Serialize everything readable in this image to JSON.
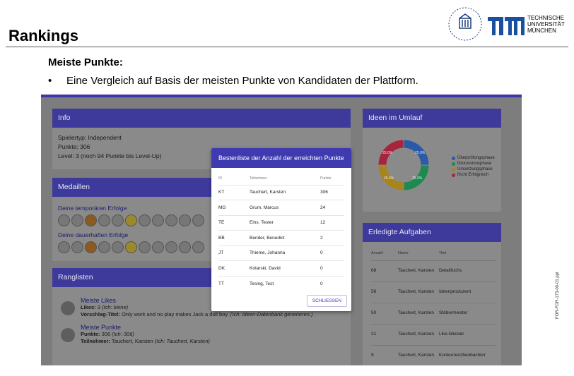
{
  "slide": {
    "title": "Rankings",
    "section_heading": "Meiste Punkte:",
    "bullet": "Eine Vergleich auf Basis der meisten Punkte von Kandidaten der Plattform.",
    "logo_text": [
      "TECHNISCHE",
      "UNIVERSITÄT",
      "MÜNCHEN"
    ],
    "side_code": "FOR-FOR-173-00-01.ppt"
  },
  "info": {
    "title": "Info",
    "lines": [
      "Spielertyp: Independent",
      "Punkte: 306",
      "Level: 3 (noch 94 Punkte bis Level-Up)"
    ]
  },
  "medals": {
    "title": "Medaillen",
    "temp_label": "Deine temporären Erfolge",
    "perm_label": "Deine dauerhaften Erfolge"
  },
  "ranklists": {
    "title": "Ranglisten",
    "items": [
      {
        "name": "Meiste Likes",
        "line1_label": "Likes:",
        "line1_value": "3",
        "line1_note": "(Ich: keine)",
        "line2_label": "Vorschlag-Titel:",
        "line2_value": "Only work and no play makes Jack a dull boy.",
        "line2_note": "(Ich: Ideen-Datenbank generieren.)"
      },
      {
        "name": "Meiste Punkte",
        "line1_label": "Punkte:",
        "line1_value": "306",
        "line1_note": "(Ich: 306)",
        "line2_label": "Teilnehmer:",
        "line2_value": "Tauchert, Karsten",
        "line2_note": "(Ich: Tauchert, Karsten)"
      }
    ]
  },
  "ideas": {
    "title": "Ideen im Umlauf",
    "legend": [
      {
        "label": "Überprüfungsphase",
        "color": "#2a5aa8"
      },
      {
        "label": "Diskussionsphase",
        "color": "#1e8a52"
      },
      {
        "label": "Umsetzungsphase",
        "color": "#a8841c"
      },
      {
        "label": "Nicht Erfolgreich",
        "color": "#a8243c"
      }
    ],
    "slice_labels": [
      "25.0%",
      "25.0%",
      "25.0%",
      "25.0%"
    ]
  },
  "tasks": {
    "title": "Erledigte Aufgaben",
    "headers": [
      "Anzahl",
      "Name",
      "Titel"
    ],
    "rows": [
      {
        "count": "68",
        "name": "Tauchert, Karsten",
        "title": "Detailfuchs"
      },
      {
        "count": "56",
        "name": "Tauchert, Karsten",
        "title": "Ideenproduzent"
      },
      {
        "count": "50",
        "name": "Tauchert, Karsten",
        "title": "Stöbermeister"
      },
      {
        "count": "21",
        "name": "Tauchert, Karsten",
        "title": "Like-Meister"
      },
      {
        "count": "9",
        "name": "Tauchert, Karsten",
        "title": "Konkurrenzbeobachter"
      }
    ]
  },
  "modal": {
    "title": "Bestenliste der Anzahl der erreichten Punkte",
    "headers": [
      "ID",
      "Teilnehmer",
      "Punkte"
    ],
    "rows": [
      {
        "id": "KT",
        "name": "Tauchert, Karsten",
        "points": "306"
      },
      {
        "id": "MG",
        "name": "Grum, Marcus",
        "points": "24"
      },
      {
        "id": "TE",
        "name": "Eins, Tester",
        "points": "12"
      },
      {
        "id": "BB",
        "name": "Bender, Benedict",
        "points": "2"
      },
      {
        "id": "JT",
        "name": "Thieme, Johanna",
        "points": "0"
      },
      {
        "id": "DK",
        "name": "Kotarski, David",
        "points": "0"
      },
      {
        "id": "TT",
        "name": "Tesing, Test",
        "points": "0"
      }
    ],
    "close_label": "SCHLIESSEN"
  }
}
